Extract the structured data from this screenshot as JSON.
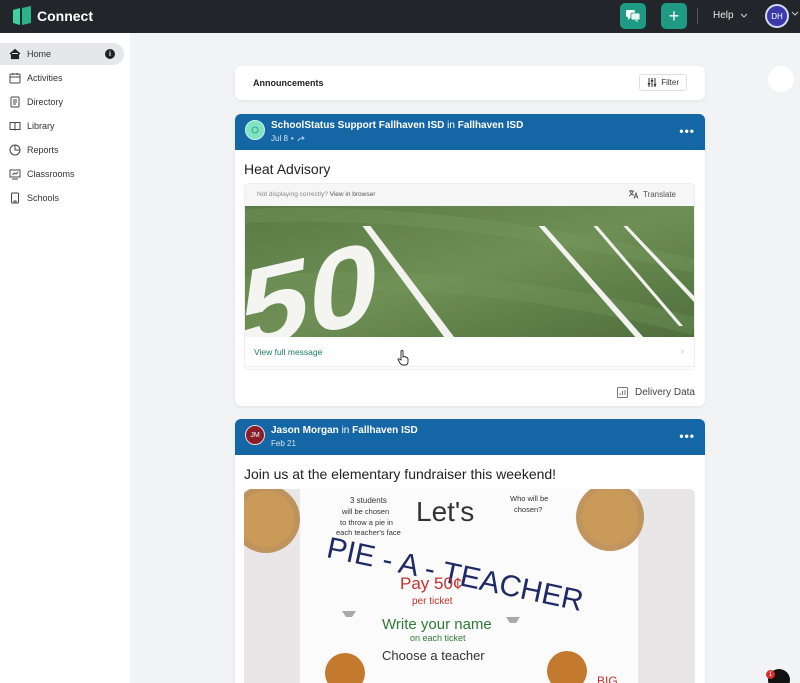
{
  "app": {
    "title": "Connect"
  },
  "topbar": {
    "help_label": "Help",
    "user_initials": "DH"
  },
  "sidebar": {
    "items": [
      {
        "label": "Home",
        "icon": "home-icon",
        "active": true,
        "info": "i"
      },
      {
        "label": "Activities",
        "icon": "calendar-icon"
      },
      {
        "label": "Directory",
        "icon": "directory-icon"
      },
      {
        "label": "Library",
        "icon": "book-icon"
      },
      {
        "label": "Reports",
        "icon": "pie-chart-icon"
      },
      {
        "label": "Classrooms",
        "icon": "classroom-icon"
      },
      {
        "label": "Schools",
        "icon": "school-icon"
      }
    ]
  },
  "announcements": {
    "title": "Announcements",
    "filter_label": "Filter"
  },
  "posts": [
    {
      "avatar": "",
      "author": "SchoolStatus Support Fallhaven ISD",
      "in_word": "in",
      "org": "Fallhaven ISD",
      "date": "Jul 8",
      "title": "Heat Advisory",
      "not_displaying": "Not displaying correctly?",
      "view_in_browser": "View in browser",
      "translate": "Translate",
      "view_full": "View full message",
      "delivery": "Delivery Data",
      "image_text": "50"
    },
    {
      "avatar": "JM",
      "author": "Jason Morgan",
      "in_word": "in",
      "org": "Fallhaven ISD",
      "date": "Feb 21",
      "title": "Join us at the elementary fundraiser this weekend!",
      "poster": {
        "line1a": "3 students",
        "line1b": "will be chosen",
        "line1c": "to throw a pie in",
        "line1d": "each teacher's face",
        "lets": "Let's",
        "who1": "Who will be",
        "who2": "chosen?",
        "headline": "PIE - A - TEACHER",
        "pay": "Pay 50¢",
        "per": "per ticket",
        "write": "Write your name",
        "each": "on each ticket",
        "choose": "Choose a teacher",
        "big": "BIG"
      }
    }
  ],
  "notification_count": "1",
  "colors": {
    "topbar": "#22262a",
    "accent": "#1f9a84",
    "post_header": "#1466a5",
    "link": "#1e7d62"
  }
}
